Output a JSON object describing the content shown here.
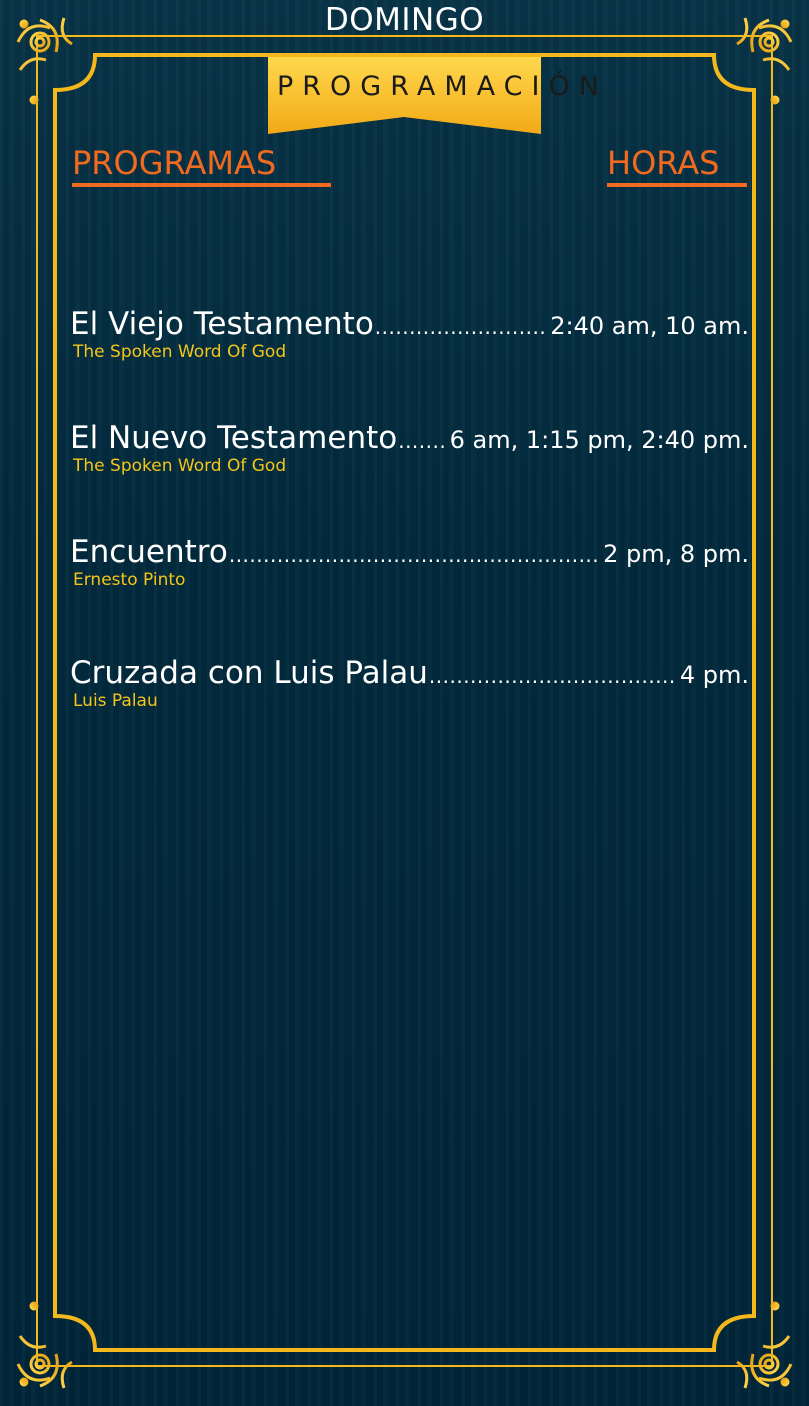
{
  "day": "DOMINGO",
  "banner": "PROGRAMACIÓN",
  "headers": {
    "programs": "PROGRAMAS",
    "hours": "HORAS"
  },
  "colors": {
    "gold": "#f5b81c",
    "orange": "#f26a1e",
    "background": "#02273a",
    "host_text": "#f5c518"
  },
  "programs": [
    {
      "name": "El Viejo Testamento",
      "host": "The Spoken Word Of God",
      "times": "2:40 am,  10 am."
    },
    {
      "name": "El Nuevo Testamento",
      "host": "The Spoken Word Of God",
      "times": "6 am,  1:15 pm,  2:40 pm."
    },
    {
      "name": "Encuentro",
      "host": "Ernesto Pinto",
      "times": "2 pm,  8 pm."
    },
    {
      "name": "Cruzada con Luis Palau",
      "host": "Luis Palau",
      "times": "4 pm."
    }
  ],
  "decorations": {
    "corner_ornament": "gold-scroll-ornament-icon"
  }
}
